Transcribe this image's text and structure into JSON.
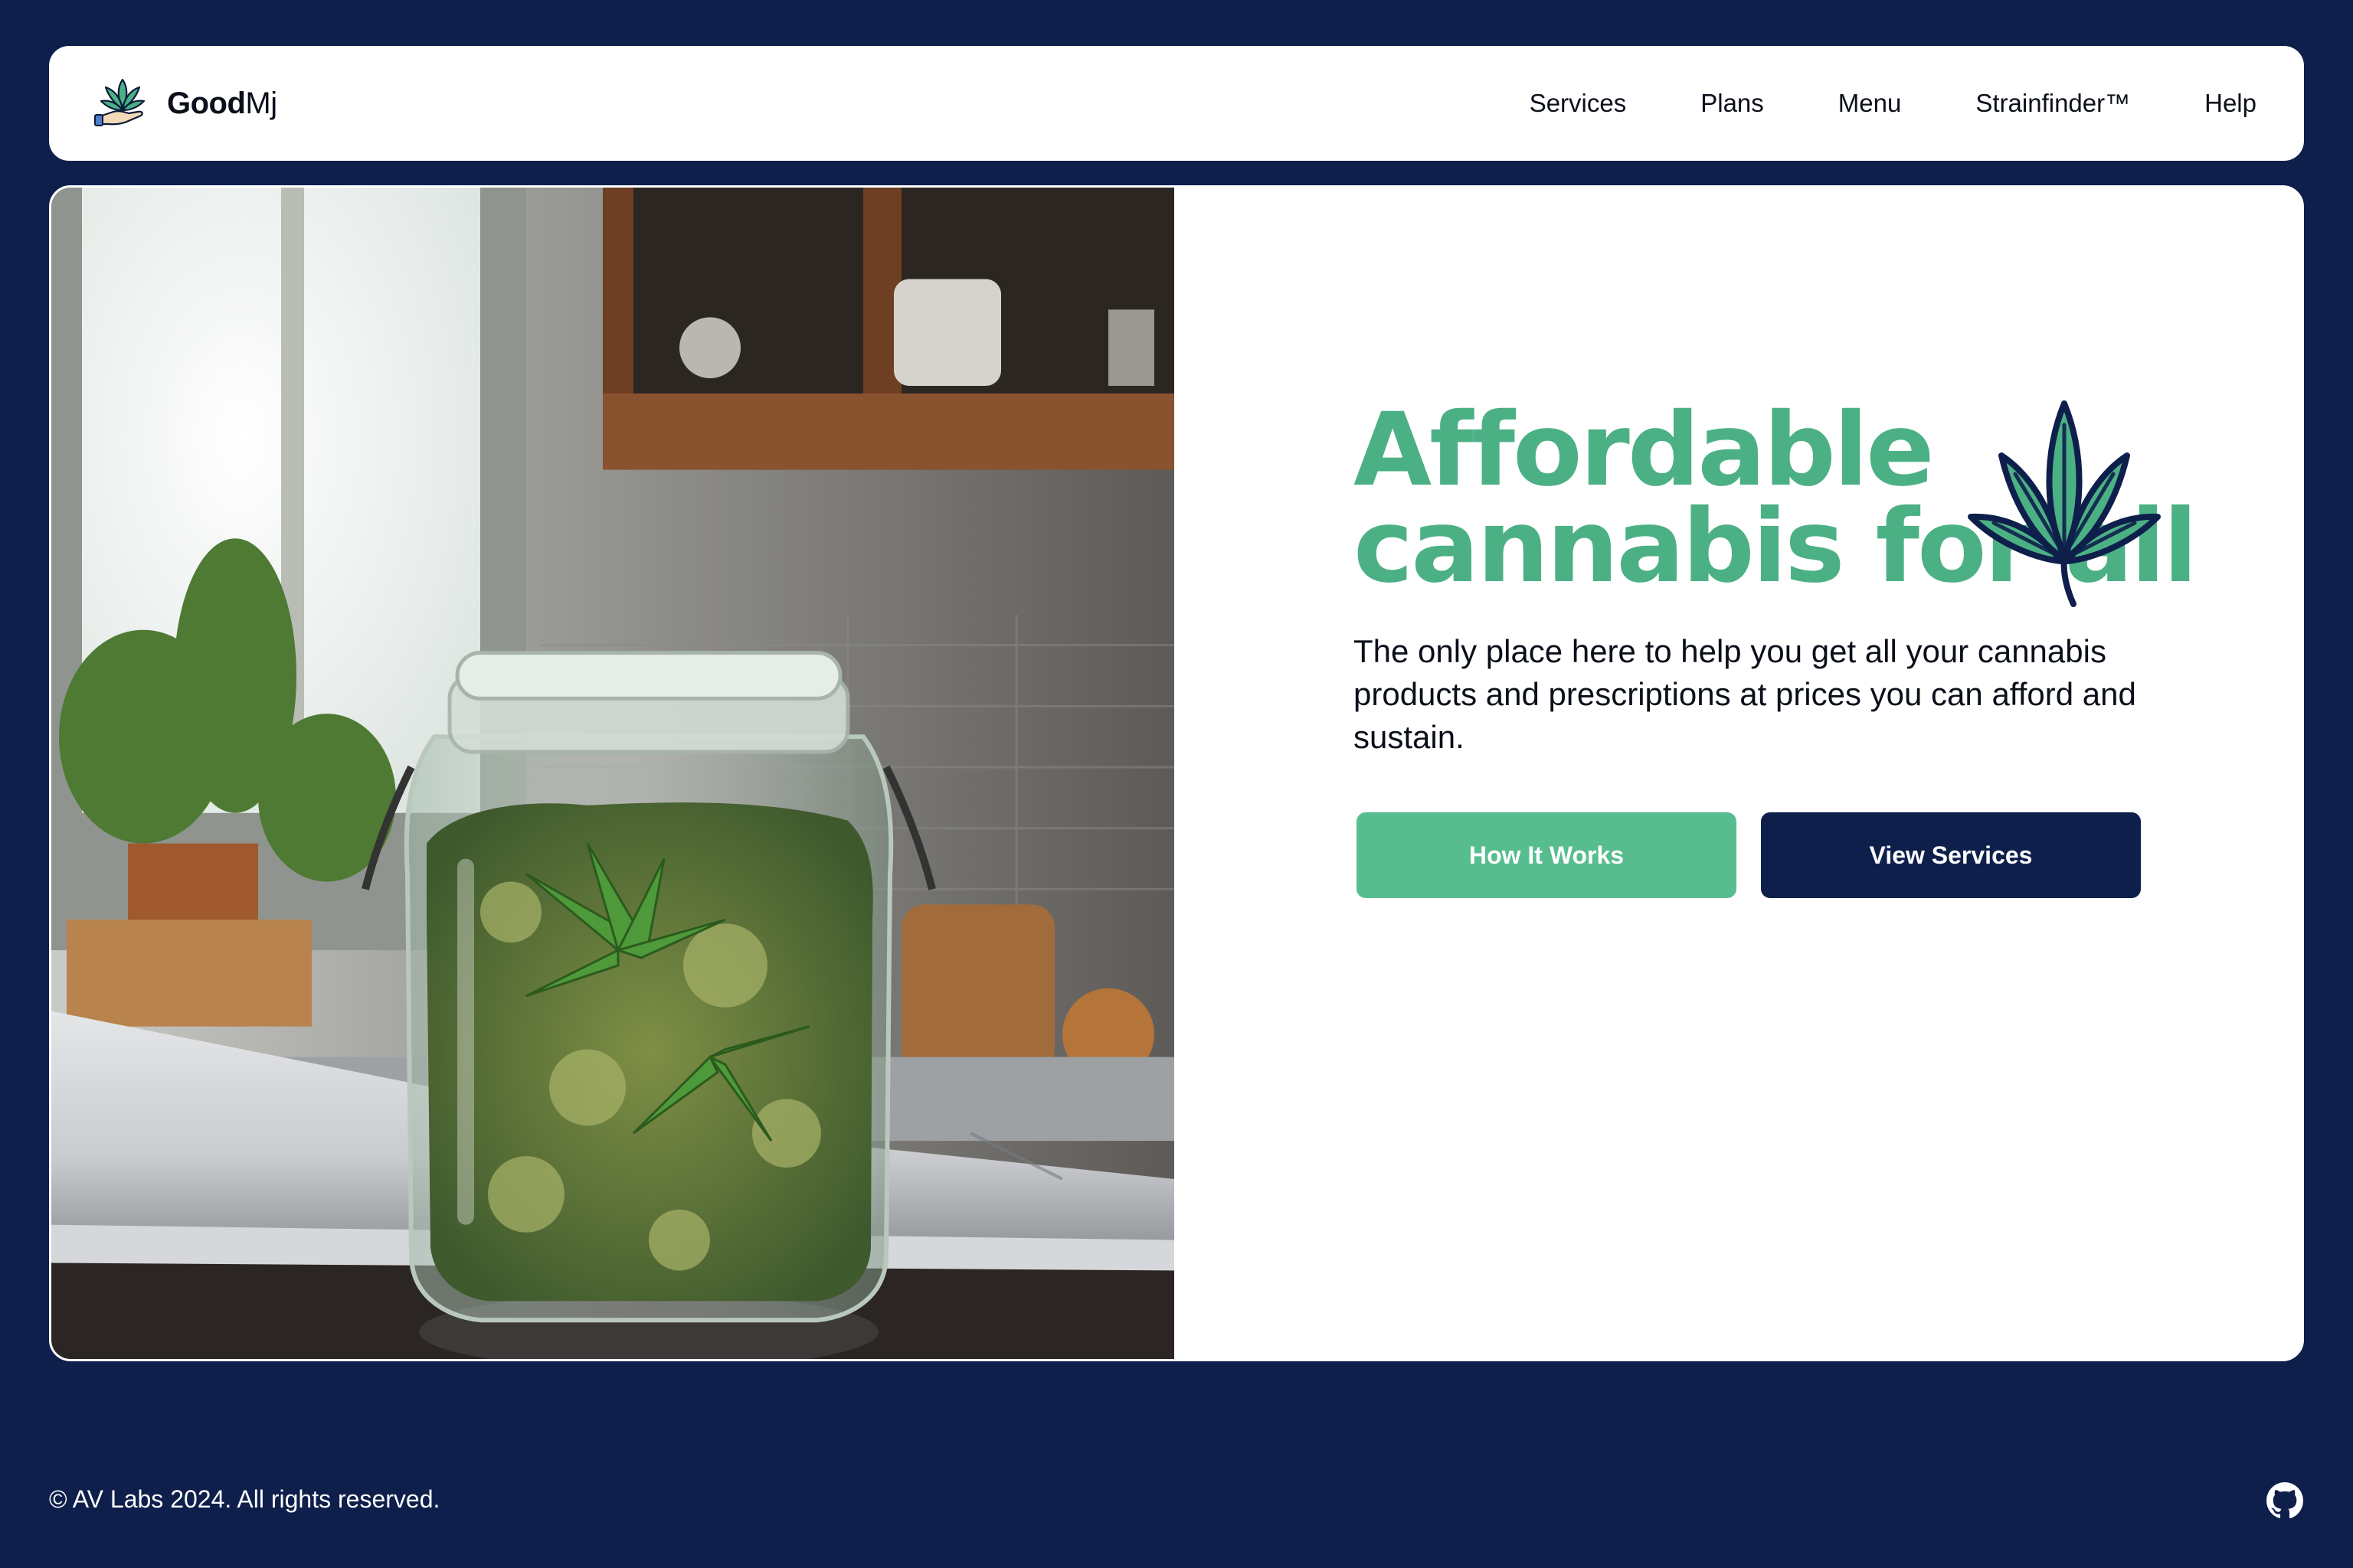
{
  "brand": {
    "bold": "Good",
    "light": "Mj",
    "logo_icon": "cannabis-hand-logo-icon"
  },
  "nav": {
    "links": [
      "Services",
      "Plans",
      "Menu",
      "Strainfinder™",
      "Help"
    ]
  },
  "hero": {
    "title_line1": "Affordable",
    "title_line2": "cannabis for all",
    "title_icon": "cannabis-leaf-icon",
    "description": "The only place here to help you get all your cannabis products and prescriptions at prices you can afford and sustain.",
    "primary_button": "How It Works",
    "secondary_button": "View Services",
    "image_icon": "cannabis-jar-photo"
  },
  "footer": {
    "copyright": "© AV Labs 2024. All rights reserved.",
    "social_icon": "github-icon"
  },
  "colors": {
    "background": "#0e1f4b",
    "accent_green": "#57bd8f",
    "title_green": "#4cb085",
    "navy": "#0e1f4b"
  }
}
